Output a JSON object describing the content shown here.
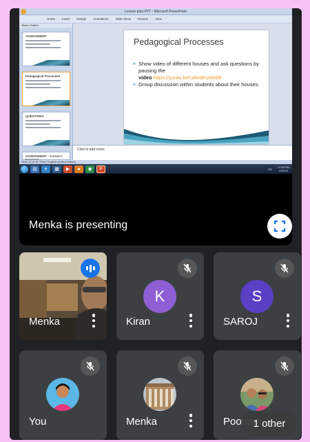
{
  "presentation": {
    "window_title": "Lesson plan.PPT - Microsoft PowerPoint",
    "ribbon_tabs": [
      "Home",
      "Insert",
      "Design",
      "Animations",
      "Slide Show",
      "Review",
      "View"
    ],
    "thumb_tabs": "Slides  Outline",
    "thumbnails": [
      {
        "title": "ASSESSMENT"
      },
      {
        "title": "Pedagogical Processes"
      },
      {
        "title": "QUESTIONS"
      },
      {
        "title": "ASSESSMENT - Correct / Incorrect"
      }
    ],
    "slide": {
      "title": "Pedagogical Processes",
      "bullet1": "Show video of different houses and ask questions by pausing the",
      "bullet1_video_label": "video",
      "bullet1_link": "https://youtu.be/udwdInzAe88",
      "bullet2": "Group discussion within students about their houses."
    },
    "notes_placeholder": "Click to add notes",
    "status_bar": "Slide 13 of 15    \"Flow\"    English (United States)",
    "tray_lang": "EN",
    "tray_time": "12:36 PM",
    "tray_date": "10/8/20",
    "presenting_label": "Menka is presenting"
  },
  "participants": [
    {
      "name": "Menka",
      "state": "speaking",
      "avatar": "video"
    },
    {
      "name": "Kiran",
      "state": "muted",
      "avatar": "K",
      "avatar_color": "#8e5fd4"
    },
    {
      "name": "SAROJ",
      "state": "muted",
      "avatar": "S",
      "avatar_color": "#5b3fc4"
    },
    {
      "name": "You",
      "state": "muted",
      "avatar": "photo"
    },
    {
      "name": "Menka",
      "state": "muted",
      "avatar": "photo"
    },
    {
      "name": "Poonam",
      "state": "muted",
      "avatar": "photo"
    }
  ],
  "overflow_pill": "1 other",
  "colors": {
    "page_bg": "#f7c2f7",
    "meet_bg": "#202124",
    "tile_bg": "#3c4043",
    "speaking_badge": "#1a73e8"
  }
}
